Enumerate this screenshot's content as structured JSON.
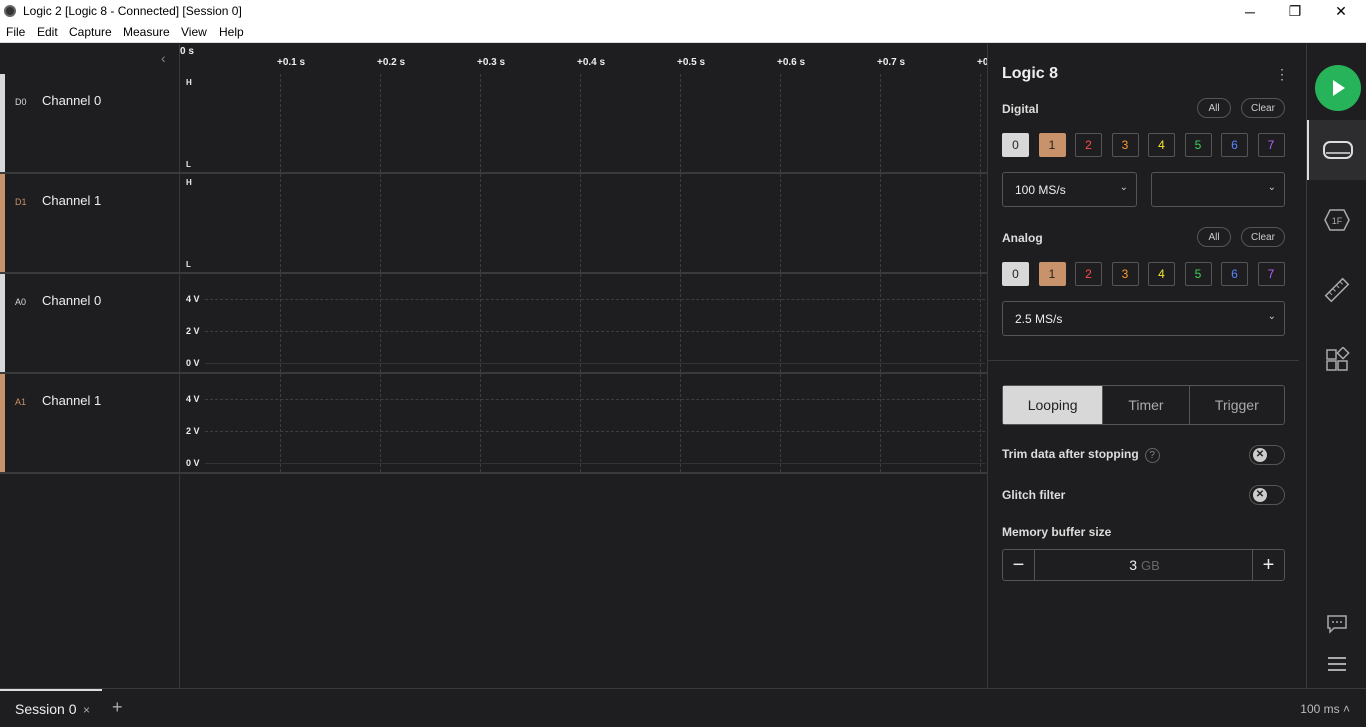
{
  "window": {
    "title": "Logic 2 [Logic 8 - Connected] [Session 0]",
    "app_icon": "logic-app-icon",
    "minimize": "─",
    "maximize": "❐",
    "close": "✕"
  },
  "menu": [
    "File",
    "Edit",
    "Capture",
    "Measure",
    "View",
    "Help"
  ],
  "ruler": {
    "zero": "0 s",
    "ticks": [
      "+0.1 s",
      "+0.2 s",
      "+0.3 s",
      "+0.4 s",
      "+0.5 s",
      "+0.6 s",
      "+0.7 s",
      "+0"
    ],
    "collapse": "‹"
  },
  "channels": [
    {
      "prefix": "D0",
      "name": "Channel 0",
      "type": "digital",
      "hi": "H",
      "lo": "L",
      "color": "#d8d8d8"
    },
    {
      "prefix": "D1",
      "name": "Channel 1",
      "type": "digital",
      "hi": "H",
      "lo": "L",
      "color": "#c8936a"
    },
    {
      "prefix": "A0",
      "name": "Channel 0",
      "type": "analog",
      "levels": [
        "4 V",
        "2 V",
        "0 V"
      ],
      "color": "#d8d8d8"
    },
    {
      "prefix": "A1",
      "name": "Channel 1",
      "type": "analog",
      "levels": [
        "4 V",
        "2 V",
        "0 V"
      ],
      "color": "#c8936a"
    }
  ],
  "panel": {
    "title": "Logic 8",
    "menu_icon": "⋮",
    "digital": {
      "label": "Digital",
      "all": "All",
      "clear": "Clear",
      "channels": [
        "0",
        "1",
        "2",
        "3",
        "4",
        "5",
        "6",
        "7"
      ],
      "rate": "100 MS/s",
      "second_select": ""
    },
    "analog": {
      "label": "Analog",
      "all": "All",
      "clear": "Clear",
      "channels": [
        "0",
        "1",
        "2",
        "3",
        "4",
        "5",
        "6",
        "7"
      ],
      "rate": "2.5 MS/s"
    },
    "channel_colors": [
      "#d8d8d8",
      "#c8936a",
      "#ff4b4b",
      "#ff9a2e",
      "#f2e52f",
      "#3dd05c",
      "#5b86ff",
      "#b760ff"
    ],
    "modes": [
      "Looping",
      "Timer",
      "Trigger"
    ],
    "active_mode": "Looping",
    "trim_label": "Trim data after stopping",
    "help": "?",
    "glitch_label": "Glitch filter",
    "toggle_knob": "✕",
    "memory_label": "Memory buffer size",
    "memory_value": "3",
    "memory_unit": "GB",
    "minus": "−",
    "plus": "+"
  },
  "rail": {
    "icons": [
      "device-settings-icon",
      "analyzers-icon",
      "measurements-icon",
      "extensions-icon",
      "feedback-icon",
      "menu-icon"
    ]
  },
  "bottom": {
    "session_tab": "Session 0",
    "close_tab": "×",
    "add_tab": "+",
    "zoom": "100 ms ˄"
  }
}
